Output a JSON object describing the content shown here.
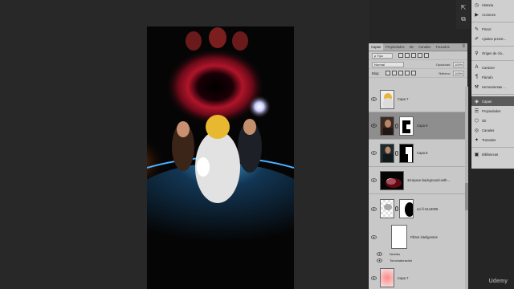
{
  "panel_tabs": [
    "Capas",
    "Propiedades",
    "3D",
    "Canales",
    "Trazados"
  ],
  "filter": {
    "kind_label": "ρ Tipo"
  },
  "blend": {
    "mode": "Normal",
    "opacity_label": "Opacidad:",
    "opacity_value": "100%"
  },
  "lock": {
    "label": "Bloq:",
    "fill_label": "Relleno:",
    "fill_value": "100%"
  },
  "layers": [
    {
      "name": "Capa 7"
    },
    {
      "name": "Capa 9",
      "selected": true
    },
    {
      "name": "Capa 8"
    },
    {
      "name": "3d-space-background-with-..."
    },
    {
      "name": "sci-fi-3144008"
    },
    {
      "name": "Filtros inteligentes"
    }
  ],
  "sub_items": [
    "Niveles",
    "Tono/saturación"
  ],
  "partial_layer": "Capa 7",
  "dock_items": [
    {
      "icon": "history-icon",
      "label": "Historia"
    },
    {
      "icon": "actions-icon",
      "label": "Acciones"
    },
    {
      "icon": "brush-icon",
      "label": "Pincel"
    },
    {
      "icon": "brush-presets-icon",
      "label": "Ajustes preest..."
    },
    {
      "icon": "clone-source-icon",
      "label": "Origen de clo..."
    },
    {
      "icon": "character-icon",
      "label": "Carácter"
    },
    {
      "icon": "paragraph-icon",
      "label": "Párrafo"
    },
    {
      "icon": "tool-presets-icon",
      "label": "Herramientas ..."
    },
    {
      "icon": "layers-icon",
      "label": "Capas",
      "active": true
    },
    {
      "icon": "properties-icon",
      "label": "Propiedades"
    },
    {
      "icon": "3d-icon",
      "label": "3D"
    },
    {
      "icon": "channels-icon",
      "label": "Canales"
    },
    {
      "icon": "paths-icon",
      "label": "Trazados"
    },
    {
      "icon": "libraries-icon",
      "label": "Bibliotecas"
    }
  ],
  "watermark": "Udemy"
}
